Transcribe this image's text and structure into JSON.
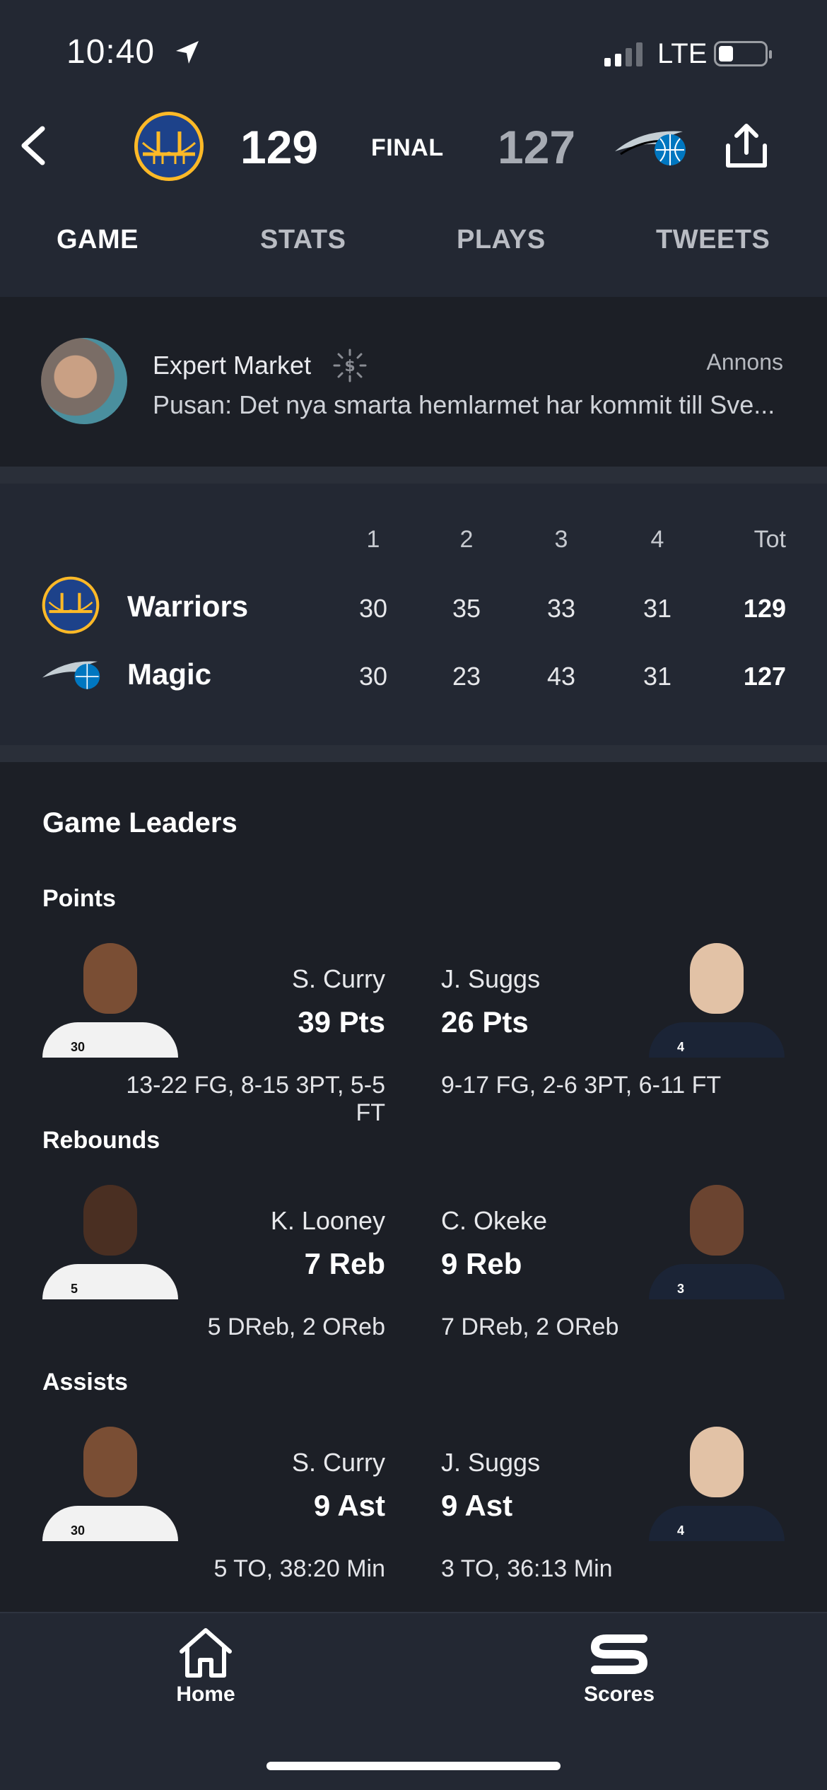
{
  "status_bar": {
    "time": "10:40",
    "network": "LTE"
  },
  "header": {
    "home_score": "129",
    "status": "FINAL",
    "away_score": "127"
  },
  "tabs": [
    {
      "label": "GAME",
      "active": true
    },
    {
      "label": "STATS",
      "active": false
    },
    {
      "label": "PLAYS",
      "active": false
    },
    {
      "label": "TWEETS",
      "active": false
    }
  ],
  "ad": {
    "title": "Expert Market",
    "label": "Annons",
    "text": "Pusan: Det nya smarta hemlarmet har kommit till Sve..."
  },
  "linescore": {
    "headers": [
      "1",
      "2",
      "3",
      "4",
      "Tot"
    ],
    "teams": [
      {
        "name": "Warriors",
        "quarters": [
          "30",
          "35",
          "33",
          "31"
        ],
        "total": "129"
      },
      {
        "name": "Magic",
        "quarters": [
          "30",
          "23",
          "43",
          "31"
        ],
        "total": "127"
      }
    ]
  },
  "leaders": {
    "title": "Game Leaders",
    "categories": [
      {
        "name": "Points",
        "home": {
          "player": "S. Curry",
          "value": "39 Pts",
          "detail": "13-22 FG, 8-15 3PT, 5-5 FT"
        },
        "away": {
          "player": "J. Suggs",
          "value": "26 Pts",
          "detail": "9-17 FG, 2-6 3PT, 6-11 FT"
        }
      },
      {
        "name": "Rebounds",
        "home": {
          "player": "K. Looney",
          "value": "7 Reb",
          "detail": "5 DReb, 2 OReb"
        },
        "away": {
          "player": "C. Okeke",
          "value": "9 Reb",
          "detail": "7 DReb, 2 OReb"
        }
      },
      {
        "name": "Assists",
        "home": {
          "player": "S. Curry",
          "value": "9 Ast",
          "detail": "5 TO, 38:20 Min"
        },
        "away": {
          "player": "J. Suggs",
          "value": "9 Ast",
          "detail": "3 TO, 36:13 Min"
        }
      }
    ]
  },
  "tabbar": {
    "home_label": "Home",
    "scores_label": "Scores"
  },
  "colors": {
    "header_bg": "#232833",
    "page_bg": "#1c1f26",
    "warriors_blue": "#1d428a",
    "warriors_gold": "#fdb927",
    "magic_blue": "#0077c0"
  }
}
